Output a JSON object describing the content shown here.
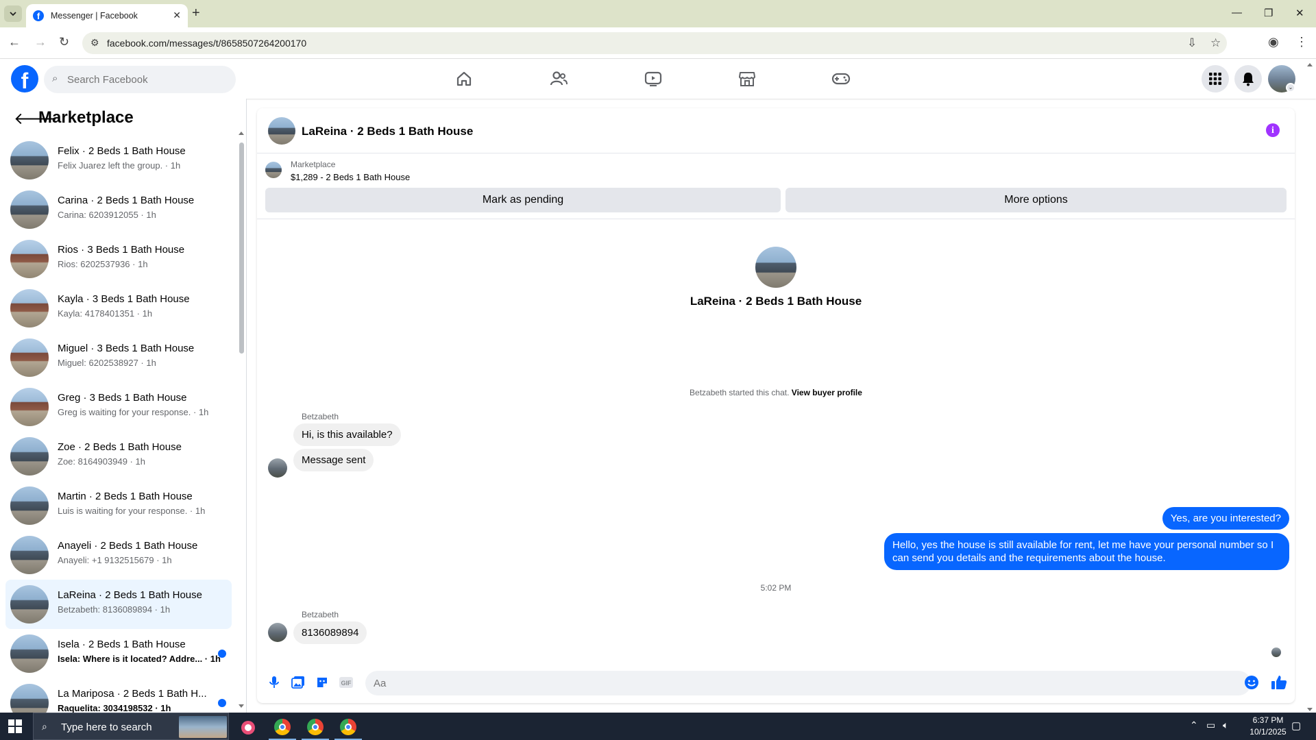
{
  "browser": {
    "tab_title": "Messenger | Facebook",
    "url": "facebook.com/messages/t/8658507264200170"
  },
  "header": {
    "search_placeholder": "Search Facebook"
  },
  "sidebar": {
    "title": "Marketplace",
    "conversations": [
      {
        "title": "Felix · 2 Beds 1 Bath House",
        "preview": "Felix Juarez left the group. · 1h",
        "unread": false
      },
      {
        "title": "Carina · 2 Beds 1 Bath House",
        "preview": "Carina: 6203912055 · 1h",
        "unread": false
      },
      {
        "title": "Rios · 3 Beds 1 Bath House",
        "preview": "Rios: 6202537936 · 1h",
        "unread": false
      },
      {
        "title": "Kayla · 3 Beds 1 Bath House",
        "preview": "Kayla: 4178401351 · 1h",
        "unread": false
      },
      {
        "title": "Miguel · 3 Beds 1 Bath House",
        "preview": "Miguel: 6202538927 · 1h",
        "unread": false
      },
      {
        "title": "Greg · 3 Beds 1 Bath House",
        "preview": "Greg is waiting for your response. · 1h",
        "unread": false
      },
      {
        "title": "Zoe · 2 Beds 1 Bath House",
        "preview": "Zoe: 8164903949 · 1h",
        "unread": false
      },
      {
        "title": "Martin · 2 Beds 1 Bath House",
        "preview": "Luis is waiting for your response. · 1h",
        "unread": false
      },
      {
        "title": "Anayeli · 2 Beds 1 Bath House",
        "preview": "Anayeli: +1 9132515679 · 1h",
        "unread": false
      },
      {
        "title": "LaReina · 2 Beds 1 Bath House",
        "preview": "Betzabeth: 8136089894 · 1h",
        "unread": false
      },
      {
        "title": "Isela · 2 Beds 1 Bath House",
        "preview": "Isela: Where is it located? Addre... · 1h",
        "unread": true
      },
      {
        "title": "La Mariposa · 2 Beds 1 Bath H...",
        "preview": "Raquelita: 3034198532 · 1h",
        "unread": true
      }
    ]
  },
  "chat": {
    "title": "LaReina · 2 Beds 1 Bath House",
    "listing": {
      "source": "Marketplace",
      "description": "$1,289 - 2 Beds 1 Bath House",
      "mark_pending_label": "Mark as pending",
      "more_options_label": "More options"
    },
    "intro_title": "LaReina · 2 Beds 1 Bath House",
    "started_text": "Betzabeth started this chat.",
    "view_buyer_profile": "View buyer profile",
    "sender_name": "Betzabeth",
    "messages_in_1": [
      "Hi, is this available?",
      "Message sent"
    ],
    "messages_out": [
      "Yes, are you interested?",
      "Hello, yes the house is still available for rent, let me have your personal number so I can send you details and the requirements about the house."
    ],
    "timestamp": "5:02 PM",
    "message_in_2": "8136089894",
    "composer_placeholder": "Aa"
  },
  "taskbar": {
    "search_placeholder": "Type here to search",
    "time": "6:37 PM",
    "date": "10/1/2025"
  },
  "colors": {
    "accent": "#0866ff",
    "info": "#a033ff",
    "selected_row": "#ebf5ff"
  }
}
